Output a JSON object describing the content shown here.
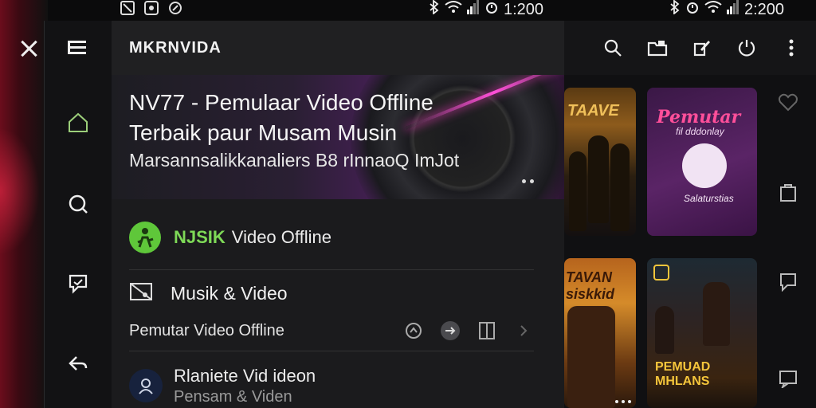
{
  "status_left": {
    "clock": "1:200"
  },
  "status_right": {
    "clock": "2:200"
  },
  "drawer": {
    "title": "MKRNVIDA",
    "hero": {
      "title_line1": "NV77 - Pemulaar Video Offline",
      "title_line2": "Terbaik paur Musam Musin",
      "subtitle": "Marsannsalikkanaliers B8 rInnaoQ ImJot"
    },
    "music": {
      "brand": "NJSIK",
      "label": "Video Offline"
    },
    "musik_video": {
      "label": "Musik & Video"
    },
    "player": {
      "label": "Pemutar Video Offline"
    },
    "user": {
      "name": "Rlaniete Vid ideon",
      "sub": "Pensam & Viden"
    }
  },
  "cards": [
    {
      "title": "TAAVE"
    },
    {
      "title": "Pemutar",
      "sub": "fil dddonlay",
      "foot": "Salaturstias"
    },
    {
      "title": "TAVAN\nsiskkid"
    },
    {
      "title": "PEMUAD MHLANS",
      "sub": ""
    }
  ],
  "icons": {
    "close": "close-icon",
    "rail": [
      "menu-icon",
      "home-icon",
      "search-icon",
      "chat-icon",
      "back-icon"
    ],
    "toolbar": [
      "search-icon",
      "folder-icon",
      "edit-icon",
      "power-icon",
      "more-icon"
    ],
    "side": [
      "heart-icon",
      "bag-icon",
      "bubble-icon",
      "message-icon"
    ]
  },
  "colors": {
    "accent_green": "#7ed957",
    "accent_pink": "#ff4f9a",
    "drawer_bg": "#1b1b1d"
  }
}
